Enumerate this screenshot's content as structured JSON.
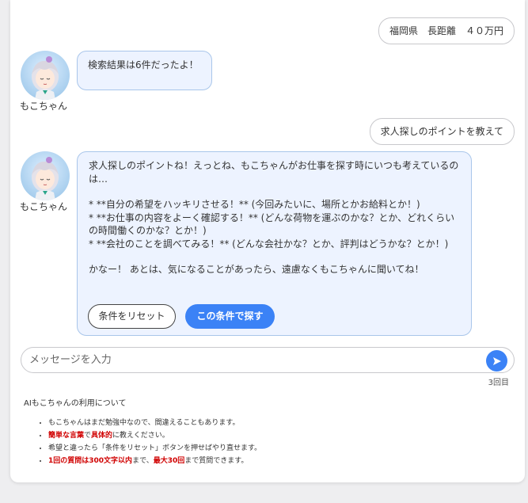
{
  "messages": {
    "user1": "福岡県　長距離　４０万円",
    "bot1": "検索結果は6件だったよ！",
    "user2": "求人探しのポイントを教えて",
    "bot2": {
      "intro": "求人探しのポイントね！えっとね、もこちゃんがお仕事を探す時にいつも考えているのは…",
      "point1": "*   **自分の希望をハッキリさせる！** (今回みたいに、場所とかお給料とか！)",
      "point2": "*   **お仕事の内容をよーく確認する！** (どんな荷物を運ぶのかな？とか、どれくらいの時間働くのかな？とか！)",
      "point3": "*   **会社のことを調べてみる！** (どんな会社かな？とか、評判はどうかな？とか！)",
      "outro": "かなー！ あとは、気になることがあったら、遠慮なくもこちゃんに聞いてね！"
    }
  },
  "bot_name": "もこちゃん",
  "buttons": {
    "reset": "条件をリセット",
    "search": "この条件で探す"
  },
  "input": {
    "placeholder": "メッセージを入力",
    "value": ""
  },
  "counter": "3回目",
  "notes": {
    "title": "AIもこちゃんの利用について",
    "item1": "もこちゃんはまだ勉強中なので、間違えることもあります。",
    "item2": {
      "a": "簡単な言葉",
      "b": "で",
      "c": "具体的",
      "d": "に教えください。"
    },
    "item3": "希望と違ったら「条件をリセット」ボタンを押せばやり直せます。",
    "item4": {
      "a": "1回の質問は300文字以内",
      "b": "まで、",
      "c": "最大30回",
      "d": "まで質問できます。"
    }
  },
  "colors": {
    "accent": "#3b82f6",
    "bot_bubble_bg": "#edf3ff",
    "bot_bubble_border": "#a9c6ea",
    "warning": "#d00000"
  },
  "icons": {
    "avatar": "mokochan-avatar",
    "send": "send-icon"
  }
}
